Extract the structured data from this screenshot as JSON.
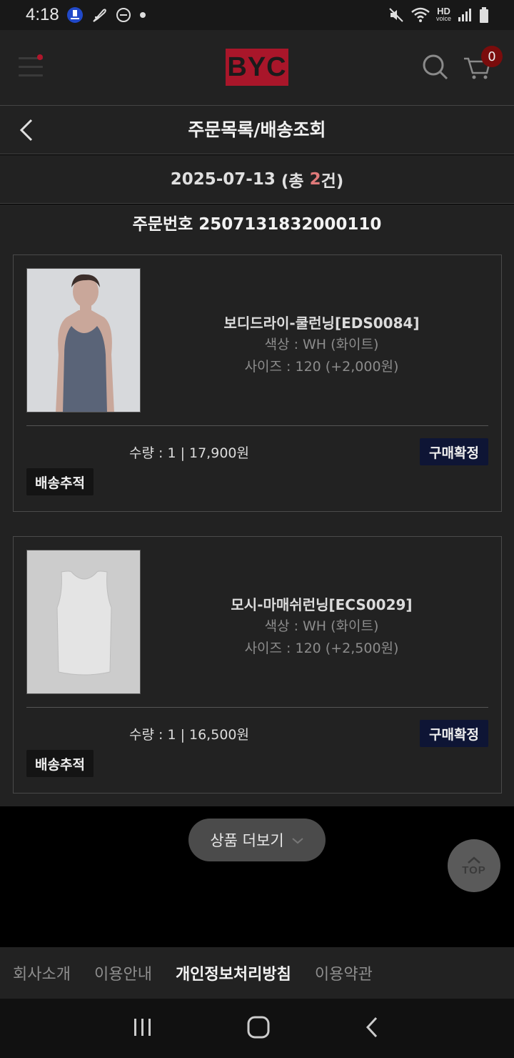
{
  "status_bar": {
    "time": "4:18",
    "network": "HD",
    "network_sub": "voice"
  },
  "header": {
    "logo": "BYC",
    "cart_count": "0"
  },
  "title_bar": {
    "title": "주문목록/배송조회"
  },
  "date_row": {
    "date": "2025-07-13",
    "count_prefix": "(총 ",
    "count": "2",
    "count_suffix": "건)"
  },
  "order": {
    "number_label": "주문번호 2507131832000110"
  },
  "items": [
    {
      "name": "보디드라이-쿨런닝[EDS0084]",
      "color": "색상 : WH (화이트)",
      "size": "사이즈 : 120 (+2,000원)",
      "qty_price": "수량 : 1 | 17,900원",
      "confirm_label": "구매확정",
      "track_label": "배송추적"
    },
    {
      "name": "모시-마매쉬런닝[ECS0029]",
      "color": "색상 : WH (화이트)",
      "size": "사이즈 : 120 (+2,500원)",
      "qty_price": "수량 : 1 | 16,500원",
      "confirm_label": "구매확정",
      "track_label": "배송추적"
    }
  ],
  "more_button": {
    "label": "상품 더보기"
  },
  "top_button": {
    "label": "TOP"
  },
  "footer": {
    "links": [
      "회사소개",
      "이용안내",
      "개인정보처리방침",
      "이용약관"
    ]
  },
  "colors": {
    "accent": "#a9162a",
    "confirm_bg": "#0e1535",
    "count_highlight": "#e07a7a"
  }
}
